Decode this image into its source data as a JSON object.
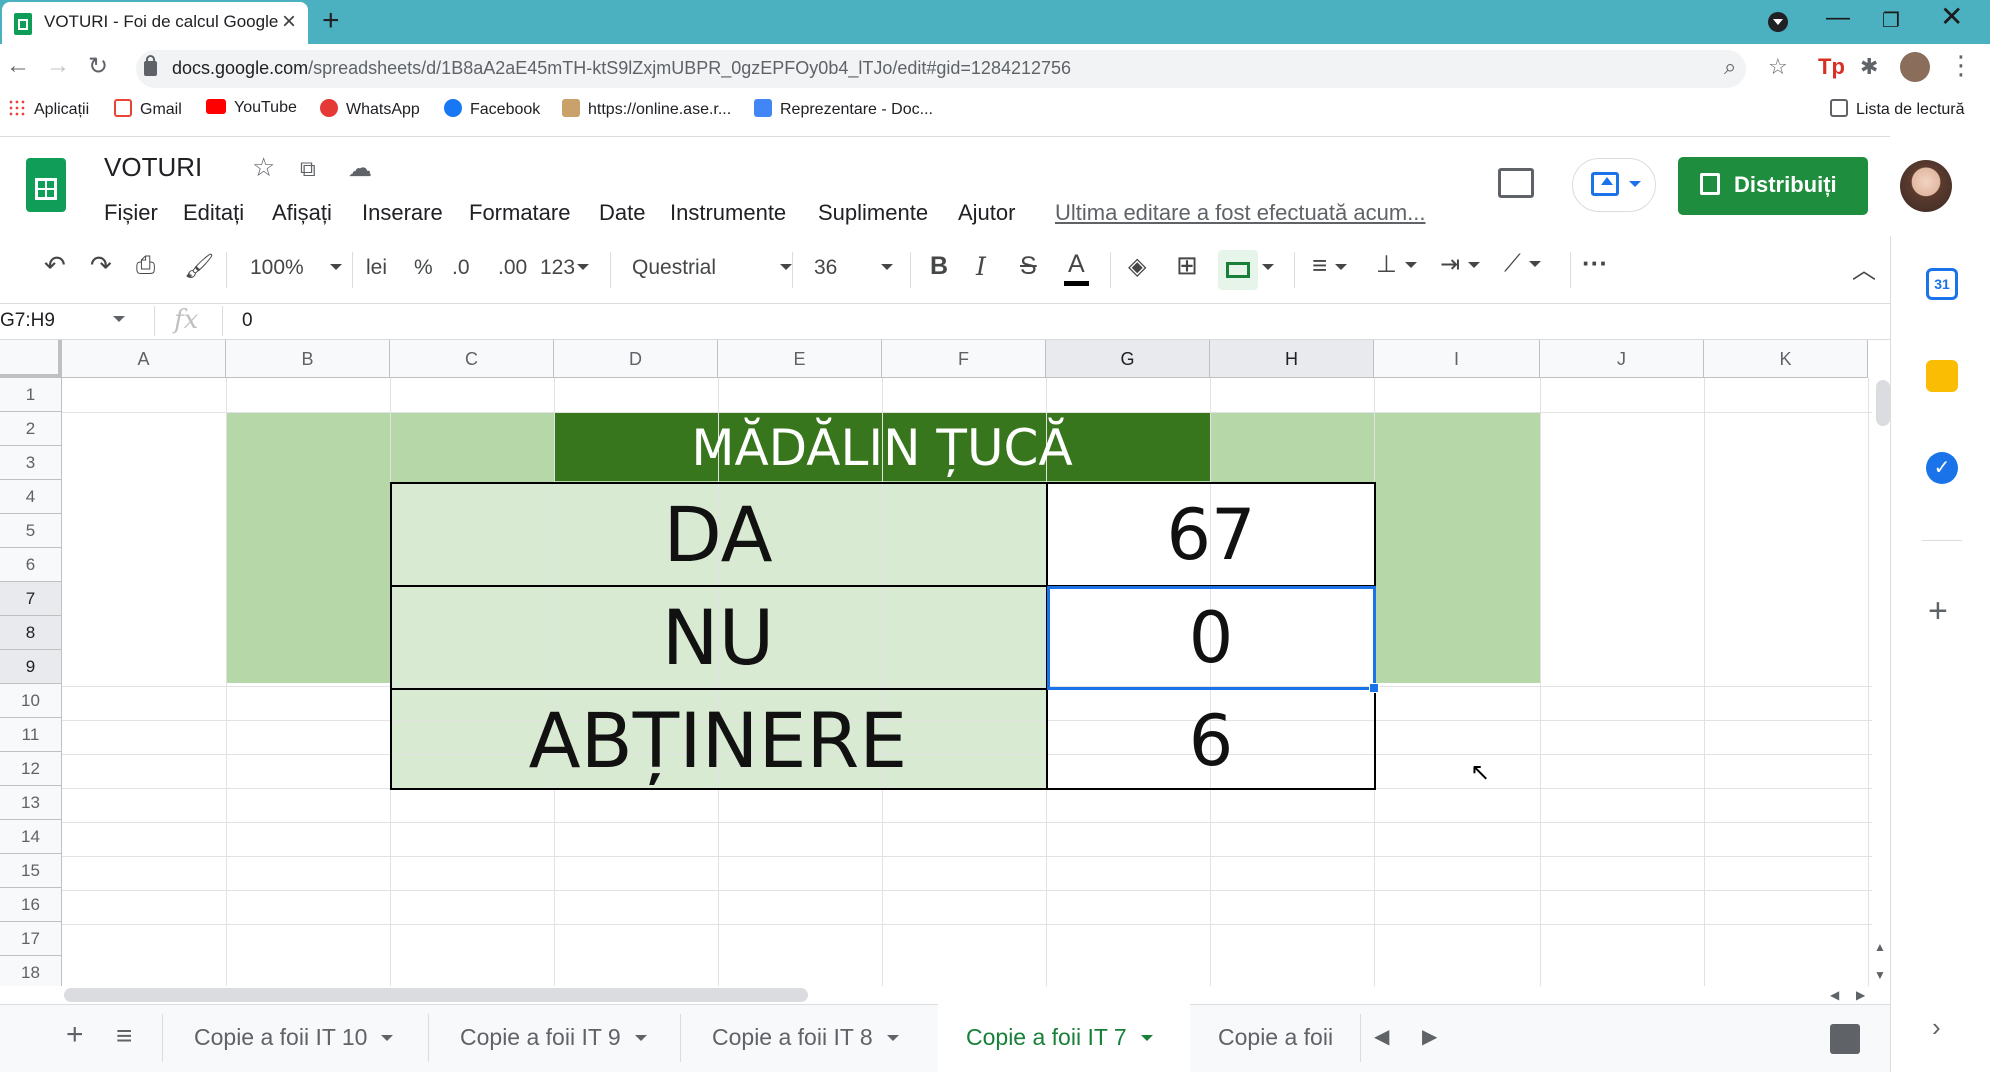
{
  "browser": {
    "tab_title": "VOTURI - Foi de calcul Google",
    "url_host": "docs.google.com",
    "url_path": "/spreadsheets/d/1B8aA2aE45mTH-ktS9lZxjmUBPR_0gzEPFOy0b4_lTJo/edit#gid=1284212756",
    "bookmarks": [
      "Aplicații",
      "Gmail",
      "YouTube",
      "WhatsApp",
      "Facebook",
      "https://online.ase.r...",
      "Reprezentare - Doc..."
    ],
    "reading_list": "Lista de lectură"
  },
  "doc": {
    "title": "VOTURI",
    "menus": [
      "Fișier",
      "Editați",
      "Afișați",
      "Inserare",
      "Formatare",
      "Date",
      "Instrumente",
      "Suplimente",
      "Ajutor"
    ],
    "last_edit": "Ultima editare a fost efectuată acum...",
    "share_label": "Distribuiți"
  },
  "toolbar": {
    "zoom": "100%",
    "currency": "lei",
    "percent": "%",
    "dec_less": ".0",
    "dec_more": ".00",
    "format_more": "123",
    "font": "Questrial",
    "font_size": "36"
  },
  "formula": {
    "namebox": "G7:H9",
    "value": "0"
  },
  "grid": {
    "columns": [
      "A",
      "B",
      "C",
      "D",
      "E",
      "F",
      "G",
      "H",
      "I",
      "J",
      "K"
    ],
    "rows": [
      "1",
      "2",
      "3",
      "4",
      "5",
      "6",
      "7",
      "8",
      "9",
      "10",
      "11",
      "12",
      "13",
      "14",
      "15",
      "16",
      "17",
      "18"
    ]
  },
  "table": {
    "header": "MĂDĂLIN ȚUCĂ",
    "rows": [
      {
        "label": "DA",
        "value": "67"
      },
      {
        "label": "NU",
        "value": "0"
      },
      {
        "label": "ABȚINERE",
        "value": "6"
      }
    ]
  },
  "sheet_tabs": [
    "Copie a foii IT 10",
    "Copie a foii IT 9",
    "Copie a foii IT 8",
    "Copie a foii IT 7",
    "Copie a foii"
  ],
  "colors": {
    "dark_green": "#38761d",
    "light_green": "#b6d7a8",
    "pale_green": "#d9ead3",
    "selection_blue": "#1a73e8"
  }
}
